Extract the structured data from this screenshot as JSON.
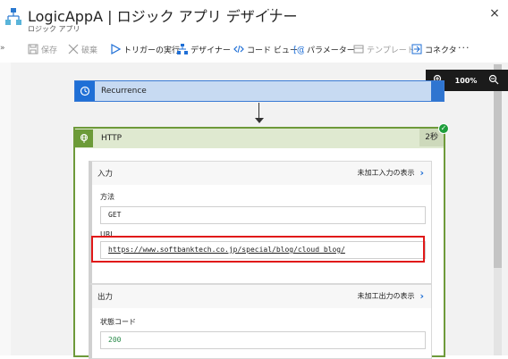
{
  "header": {
    "title": "LogicAppA | ロジック アプリ デザイナー",
    "subtitle": "ロジック アプリ",
    "more_label": "···",
    "close_label": "×"
  },
  "toolbar": {
    "expand_label": "»",
    "items": [
      {
        "label": "保存",
        "icon": "save-icon",
        "enabled": false
      },
      {
        "label": "破棄",
        "icon": "discard-icon",
        "enabled": false
      },
      {
        "label": "トリガーの実行",
        "icon": "play-icon",
        "enabled": true
      },
      {
        "label": "デザイナー",
        "icon": "designer-icon",
        "enabled": true
      },
      {
        "label": "コード ビュー",
        "icon": "code-icon",
        "enabled": true
      },
      {
        "label": "パラメーター",
        "icon": "parameters-icon",
        "enabled": true
      },
      {
        "label": "テンプレート",
        "icon": "templates-icon",
        "enabled": false
      },
      {
        "label": "コネクタ",
        "icon": "connector-icon",
        "enabled": true
      }
    ],
    "more_label": "···"
  },
  "zoom": {
    "level": "100%",
    "zoom_in_icon": "zoom-in-icon",
    "zoom_out_icon": "zoom-out-icon"
  },
  "recurrence": {
    "label": "Recurrence",
    "icon": "clock-icon"
  },
  "http": {
    "label": "HTTP",
    "icon": "globe-icon",
    "duration": "2秒",
    "status": "succeeded",
    "status_icon": "check-icon",
    "input": {
      "title": "入力",
      "link_label": "未加工入力の表示",
      "method_label": "方法",
      "method_value": "GET",
      "uri_label": "URI",
      "uri_value": "https://www.softbanktech.co.jp/special/blog/cloud_blog/"
    },
    "output": {
      "title": "出力",
      "link_label": "未加工出力の表示",
      "status_code_label": "状態コード",
      "status_code_value": "200"
    }
  },
  "colors": {
    "accent_blue": "#1f6fd6",
    "http_green": "#6c9b38",
    "success_green": "#1e9e3c",
    "highlight_red": "#e01919"
  }
}
